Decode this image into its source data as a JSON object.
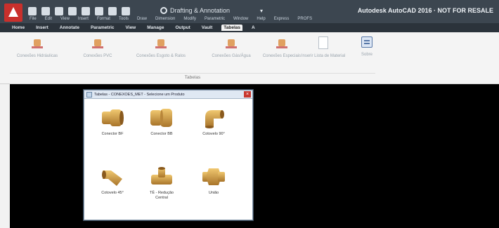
{
  "window": {
    "workspace": "Drafting & Annotation",
    "app_title": "Autodesk AutoCAD 2016 · NOT FOR RESALE"
  },
  "menubar": [
    "File",
    "Edit",
    "View",
    "Insert",
    "Format",
    "Tools",
    "Draw",
    "Dimension",
    "Modify",
    "Parametric",
    "Window",
    "Help",
    "Express",
    "PROFS"
  ],
  "ribbon_tabs": [
    "Home",
    "Insert",
    "Annotate",
    "Parametric",
    "View",
    "Manage",
    "Output",
    "Vault",
    "Tabelas",
    "A"
  ],
  "ribbon": {
    "buttons": [
      {
        "label": "Conexões Hidráulicas",
        "icon": "pipe-fitting-icon"
      },
      {
        "label": "Conexões PVC",
        "icon": "pipe-fitting-icon"
      },
      {
        "label": "Conexões Esgoto & Ralos",
        "icon": "pipe-fitting-icon"
      },
      {
        "label": "Conexões Gás/Água",
        "icon": "pipe-fitting-icon"
      },
      {
        "label": "Conexões Especiais",
        "icon": "pipe-fitting-icon"
      },
      {
        "label": "Inserir Lista de Material",
        "icon": "document-icon"
      },
      {
        "label": "Sobre",
        "icon": "info-panel-icon"
      }
    ],
    "panel_label": "Tabelas"
  },
  "dialog": {
    "title": "Tabelas - CONEXÕES_MET - Selecione um Produto",
    "items": [
      {
        "label": "Conector BF",
        "icon": "connector-fitting-icon"
      },
      {
        "label": "Conector BB",
        "icon": "connector-fitting-icon"
      },
      {
        "label": "Cotovelo 90°",
        "icon": "elbow-fitting-icon"
      },
      {
        "label": "Cotovelo 45°",
        "icon": "elbow-fitting-icon"
      },
      {
        "label": "TÊ - Redução Central",
        "icon": "tee-fitting-icon"
      },
      {
        "label": "União",
        "icon": "union-fitting-icon"
      }
    ]
  },
  "colors": {
    "titlebar": "#3c4650",
    "ribbon_tabs": "#2b333b",
    "canvas": "#000000",
    "brass": "#c9953a",
    "app_logo": "#c9302c"
  }
}
